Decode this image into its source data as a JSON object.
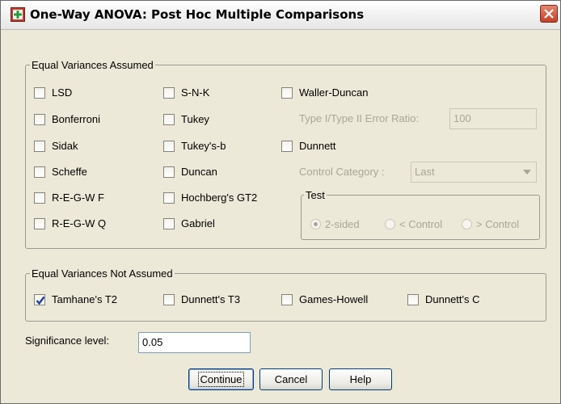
{
  "window": {
    "title": "One-Way ANOVA: Post Hoc Multiple Comparisons",
    "icon": "spss-dialog-icon",
    "close_icon": "close-icon"
  },
  "equal_assumed": {
    "legend": "Equal Variances Assumed",
    "col1": [
      {
        "key": "lsd",
        "label": "LSD",
        "checked": false
      },
      {
        "key": "bonferroni",
        "label": "Bonferroni",
        "checked": false
      },
      {
        "key": "sidak",
        "label": "Sidak",
        "checked": false
      },
      {
        "key": "scheffe",
        "label": "Scheffe",
        "checked": false
      },
      {
        "key": "regwf",
        "label": "R-E-G-W F",
        "checked": false
      },
      {
        "key": "regwq",
        "label": "R-E-G-W Q",
        "checked": false
      }
    ],
    "col2": [
      {
        "key": "snk",
        "label": "S-N-K",
        "checked": false
      },
      {
        "key": "tukey",
        "label": "Tukey",
        "checked": false
      },
      {
        "key": "tukeyb",
        "label": "Tukey's-b",
        "checked": false
      },
      {
        "key": "duncan",
        "label": "Duncan",
        "checked": false
      },
      {
        "key": "hochberg",
        "label": "Hochberg's GT2",
        "checked": false
      },
      {
        "key": "gabriel",
        "label": "Gabriel",
        "checked": false
      }
    ],
    "waller": {
      "label": "Waller-Duncan",
      "checked": false
    },
    "error_ratio": {
      "label": "Type I/Type II Error Ratio:",
      "value": "100"
    },
    "dunnett": {
      "label": "Dunnett",
      "checked": false
    },
    "control_category": {
      "label": "Control Category :",
      "value": "Last"
    },
    "test": {
      "legend": "Test",
      "options": [
        {
          "label": "2-sided",
          "selected": true
        },
        {
          "label": "< Control",
          "selected": false
        },
        {
          "label": "> Control",
          "selected": false
        }
      ]
    }
  },
  "not_assumed": {
    "legend": "Equal Variances Not Assumed",
    "items": [
      {
        "key": "t2",
        "label": "Tamhane's T2",
        "checked": true
      },
      {
        "key": "t3",
        "label": "Dunnett's T3",
        "checked": false
      },
      {
        "key": "gh",
        "label": "Games-Howell",
        "checked": false
      },
      {
        "key": "dc",
        "label": "Dunnett's C",
        "checked": false
      }
    ]
  },
  "significance": {
    "label": "Significance level:",
    "value": "0.05"
  },
  "buttons": {
    "continue": "Continue",
    "cancel": "Cancel",
    "help": "Help"
  }
}
